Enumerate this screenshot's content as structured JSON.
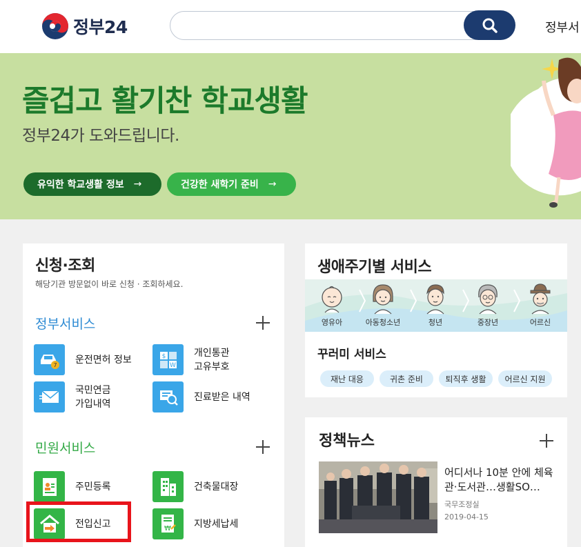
{
  "header": {
    "logo_text": "정부24",
    "search_placeholder": "",
    "menu_label": "정부서"
  },
  "banner": {
    "title": "즐겁고 활기찬 학교생활",
    "subtitle": "정부24가 도와드립니다.",
    "button1": "유익한 학교생활 정보",
    "button2": "건강한 새학기 준비",
    "arrow": "→"
  },
  "apply": {
    "title": "신청·조회",
    "desc": "해당기관 방문없이 바로 신청 · 조회하세요.",
    "gov": {
      "title": "정부서비스",
      "items": [
        {
          "label": "운전면허 정보"
        },
        {
          "label": "개인통관",
          "label2": "고유부호"
        },
        {
          "label": "국민연금",
          "label2": "가입내역"
        },
        {
          "label": "진료받은 내역"
        }
      ]
    },
    "civil": {
      "title": "민원서비스",
      "items": [
        {
          "label": "주민등록"
        },
        {
          "label": "건축물대장"
        },
        {
          "label": "전입신고"
        },
        {
          "label": "지방세납세"
        }
      ]
    }
  },
  "life": {
    "title": "생애주기별 서비스",
    "stages": [
      "영유아",
      "아동청소년",
      "청년",
      "중장년",
      "어르신"
    ],
    "kk_title": "꾸러미 서비스",
    "chips": [
      "재난 대응",
      "귀촌 준비",
      "퇴직후 생활",
      "어르신 지원"
    ]
  },
  "news": {
    "title": "정책뉴스",
    "headline": "어디서나 10분 안에 체육관·도서관…생활SO…",
    "source": "국무조정실",
    "date": "2019-04-15"
  },
  "colors": {
    "brand_navy": "#1c3b6f",
    "banner_bg": "#c7dfa0",
    "banner_title": "#1c7a2b",
    "service_blue": "#3aa6e8",
    "service_green": "#33b547",
    "highlight_red": "#e8141b"
  }
}
